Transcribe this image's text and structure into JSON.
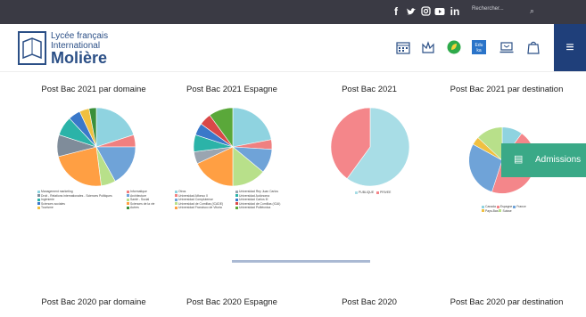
{
  "topbar": {
    "social": [
      "f",
      "t",
      "ig",
      "yt",
      "in"
    ],
    "search_placeholder": "Rechercher...",
    "search_icon": "search-icon"
  },
  "logo": {
    "line1": "Lycée français",
    "line2": "International",
    "line3": "Molière"
  },
  "header_icons": [
    "calendar-icon",
    "people-icon",
    "leaf-icon",
    "edu-icon",
    "laptop-icon",
    "bag-icon"
  ],
  "menu": {
    "icon": "≡"
  },
  "admissions": {
    "label": "Admissions",
    "icon": "▤"
  },
  "titles_2021": [
    "Post Bac 2021 par domaine",
    "Post Bac 2021 Espagne",
    "Post Bac 2021",
    "Post Bac 2021 par destination"
  ],
  "titles_2020": [
    "Post Bac 2020 par domaine",
    "Post Bac 2020 Espagne",
    "Post Bac 2020",
    "Post Bac 2020 par destination"
  ],
  "legend_domaine": {
    "left": [
      "Management marketing",
      "Droit - Relations internationales - Sciences Politiques",
      "Ingénierie",
      "Sciences sociales",
      "Tourisme"
    ],
    "right": [
      "Informatique",
      "Architecture",
      "Santé - Social",
      "Sciences de la vie",
      "Autres"
    ]
  },
  "legend_espagne": {
    "left": [
      "Otros",
      "Universidad Alfonso X",
      "Universidad Complutense",
      "Universidad de Comillas (ICADE)",
      "Universidad Francisco de Vitoria"
    ],
    "right": [
      "Universidad Rey Juan Carlos",
      "Universidad Autónoma",
      "Universidad Carlos III",
      "Universidad de Comillas (ICAI)",
      "Universidad Politécnica"
    ]
  },
  "legend_2021": [
    "PUBLIQUE",
    "PRIVEE"
  ],
  "legend_destination": [
    "Canada",
    "Espagne",
    "France",
    "Pays-Bas",
    "Suisse"
  ],
  "chart_data": [
    {
      "type": "pie",
      "title": "Post Bac 2021 par domaine",
      "labels": [
        "Management marketing",
        "Informatique",
        "Architecture",
        "Santé - Social",
        "Sciences de la vie",
        "Droit - Relations internationales - Sciences Politiques",
        "Ingénierie",
        "Sciences sociales",
        "Tourisme",
        "Autres"
      ],
      "values": [
        20,
        5,
        17,
        6,
        23,
        9,
        8,
        5,
        4,
        3
      ],
      "colors": [
        "#8fd3e0",
        "#f08080",
        "#6fa3d8",
        "#b8e08a",
        "#ff9f43",
        "#7f8c9a",
        "#2bb3a8",
        "#3a78c9",
        "#f0c040",
        "#3a8f3a"
      ]
    },
    {
      "type": "pie",
      "title": "Post Bac 2021 Espagne",
      "labels": [
        "Otros",
        "Universidad Alfonso X",
        "Universidad Complutense",
        "Universidad de Comillas (ICADE)",
        "Universidad Francisco de Vitoria",
        "Universidad Rey Juan Carlos",
        "Universidad Autónoma",
        "Universidad Carlos III",
        "Universidad de Comillas (ICAI)",
        "Universidad Politécnica"
      ],
      "values": [
        22,
        4,
        10,
        14,
        18,
        5,
        7,
        5,
        5,
        10
      ],
      "colors": [
        "#8fd3e0",
        "#f08080",
        "#6fa3d8",
        "#b8e08a",
        "#ff9f43",
        "#9aa5b1",
        "#2bb3a8",
        "#3a78c9",
        "#d94848",
        "#5aa83a"
      ]
    },
    {
      "type": "pie",
      "title": "Post Bac 2021",
      "labels": [
        "PUBLIQUE",
        "PRIVEE"
      ],
      "values": [
        60,
        40
      ],
      "colors": [
        "#a8dde6",
        "#f4868a"
      ]
    },
    {
      "type": "pie",
      "title": "Post Bac 2021 par destination",
      "labels": [
        "Canada",
        "Espagne",
        "France",
        "Pays-Bas",
        "Suisse"
      ],
      "values": [
        10,
        45,
        28,
        4,
        13
      ],
      "colors": [
        "#8fd3e0",
        "#f4868a",
        "#6fa3d8",
        "#f0c040",
        "#b8e08a"
      ]
    }
  ]
}
